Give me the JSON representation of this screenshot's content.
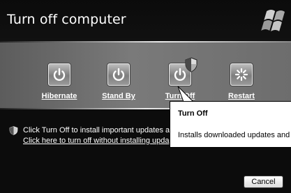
{
  "dialog": {
    "title": "Turn off computer",
    "logo_icon": "windows-flag-logo"
  },
  "options": [
    {
      "label": "Hibernate",
      "icon": "power-icon"
    },
    {
      "label": "Stand By",
      "icon": "power-icon"
    },
    {
      "label": "Turn Off",
      "icon": "power-icon",
      "badge_icon": "shield-icon"
    },
    {
      "label": "Restart",
      "icon": "restart-icon"
    }
  ],
  "info": {
    "icon": "shield-icon",
    "line1": "Click Turn Off to install important updates a",
    "line2": "Click here to turn off without installing upda"
  },
  "tooltip": {
    "title": "Turn Off",
    "body": "Installs downloaded updates and"
  },
  "footer": {
    "cancel_label": "Cancel"
  }
}
